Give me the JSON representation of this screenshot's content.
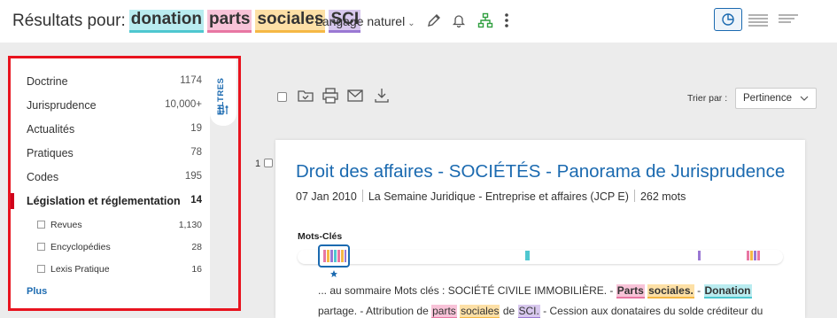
{
  "header": {
    "prefix": "Résultats pour:",
    "terms": [
      "donation",
      "parts",
      "sociales",
      "SCI"
    ],
    "language_mode": "Langage naturel",
    "icons": [
      "pencil-icon",
      "bell-icon",
      "hierarchy-icon",
      "more-vertical-icon",
      "chart-view-icon",
      "list-view-icon",
      "compact-view-icon"
    ]
  },
  "sidebar": {
    "filter_tab_label": "FILTRES",
    "items": [
      {
        "label": "Doctrine",
        "count": "1174"
      },
      {
        "label": "Jurisprudence",
        "count": "10,000+"
      },
      {
        "label": "Actualités",
        "count": "19"
      },
      {
        "label": "Pratiques",
        "count": "78"
      },
      {
        "label": "Codes",
        "count": "195"
      },
      {
        "label": "Législation et réglementation",
        "count": "14",
        "active": true
      }
    ],
    "subitems": [
      {
        "label": "Revues",
        "count": "1,130"
      },
      {
        "label": "Encyclopédies",
        "count": "28"
      },
      {
        "label": "Lexis Pratique",
        "count": "16"
      }
    ],
    "more_label": "Plus"
  },
  "toolbar": {
    "icons": [
      "select-all-checkbox",
      "folder-icon",
      "print-icon",
      "mail-icon",
      "download-icon"
    ],
    "sort_label": "Trier par :",
    "sort_value": "Pertinence"
  },
  "result": {
    "number": "1",
    "title": "Droit des affaires - SOCIÉTÉS - Panorama de Jurisprudence",
    "date": "07 Jan 2010",
    "source": "La Semaine Juridique - Entreprise et affaires (JCP E)",
    "words": "262 mots",
    "keywords_label": "Mots-Clés",
    "snippet1": {
      "pre": "... au sommaire Mots clés : SOCIÉTÉ CIVILE IMMOBILIÈRE. - ",
      "h1": "Parts",
      "h2": "sociales.",
      "mid": " - ",
      "h3": "Donation"
    },
    "snippet2": {
      "pre": "partage. - Attribution de ",
      "h1": "parts",
      "h2": "sociales",
      "mid": " de ",
      "h3": "SCI.",
      "post": " - Cession aux donataires du solde créditeur du"
    }
  },
  "colors": {
    "brand_blue": "#1b6ab0",
    "highlight_box": "#e8131e",
    "term_donation": "#4fc7d0",
    "term_parts": "#e877a3",
    "term_sociales": "#f5b845",
    "term_sci": "#9a78d3"
  }
}
